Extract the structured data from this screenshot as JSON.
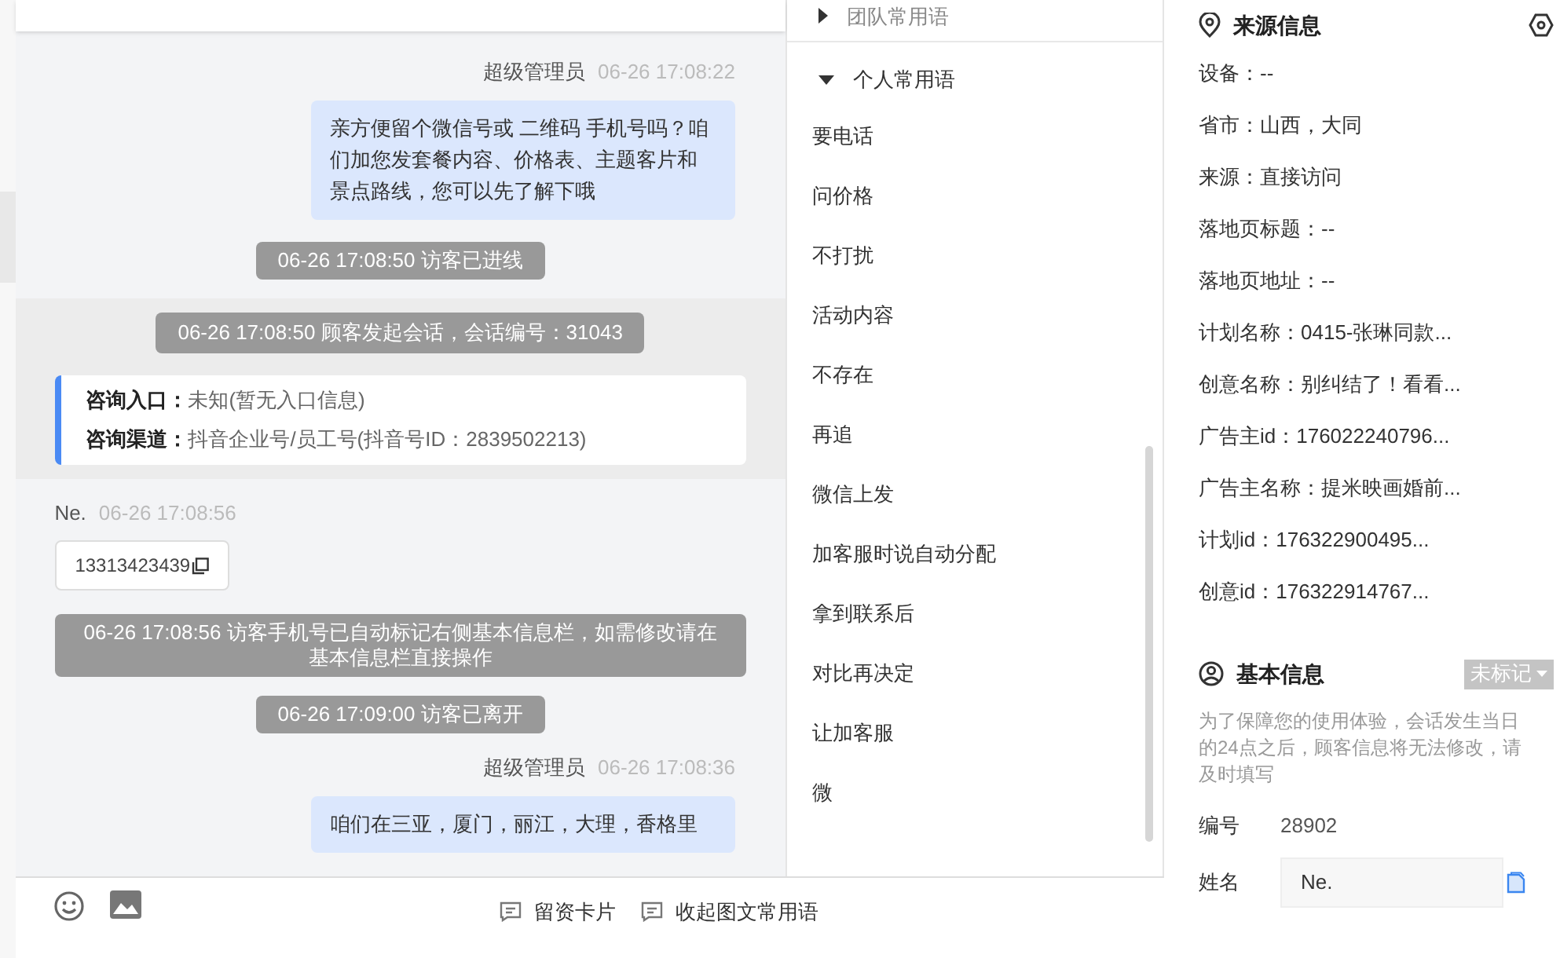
{
  "chat": {
    "messages": [
      {
        "kind": "agent",
        "sender": "超级管理员",
        "time": "06-26 17:08:22",
        "text": "亲方便留个微信号或 二维码 手机号吗？咱们加您发套餐内容、价格表、主题客片和景点路线，您可以先了解下哦"
      },
      {
        "kind": "system",
        "text": "06-26 17:08:50 访客已进线"
      },
      {
        "kind": "session",
        "text": "06-26 17:08:50 顾客发起会话，会话编号：31043",
        "fields": [
          {
            "label": "咨询入口：",
            "value": "未知(暂无入口信息)"
          },
          {
            "label": "咨询渠道：",
            "value": "抖音企业号/员工号(抖音号ID：2839502213)"
          }
        ]
      },
      {
        "kind": "visitor",
        "sender": "Ne.",
        "time": "06-26 17:08:56",
        "text": "13313423439"
      },
      {
        "kind": "system",
        "text": "06-26 17:08:56 访客手机号已自动标记右侧基本信息栏，如需修改请在基本信息栏直接操作"
      },
      {
        "kind": "system",
        "text": "06-26 17:09:00 访客已离开"
      },
      {
        "kind": "agent",
        "sender": "超级管理员",
        "time": "06-26 17:08:36",
        "text": "咱们在三亚，厦门，丽江，大理，香格里"
      }
    ]
  },
  "phrases": {
    "groups": [
      {
        "label": "团队常用语",
        "expanded": false
      },
      {
        "label": "个人常用语",
        "expanded": true
      }
    ],
    "items": [
      "要电话",
      "问价格",
      "不打扰",
      "活动内容",
      "不存在",
      "再追",
      "微信上发",
      "加客服时说自动分配",
      "拿到联系后",
      "对比再决定",
      "让加客服",
      "微"
    ],
    "footer": [
      "留资卡片",
      "收起图文常用语"
    ]
  },
  "source_info": {
    "title": "来源信息",
    "rows": [
      "设备：--",
      "省市：山西，大同",
      "来源：直接访问",
      "落地页标题：--",
      "落地页地址：--",
      "计划名称：0415-张琳同款...",
      "创意名称：别纠结了！看看...",
      "广告主id：176022240796...",
      "广告主名称：提米映画婚前...",
      "计划id：176322900495...",
      "创意id：176322914767..."
    ]
  },
  "basic_info": {
    "title": "基本信息",
    "tag": "未标记",
    "notice": "为了保障您的使用体验，会话发生当日的24点之后，顾客信息将无法修改，请及时填写",
    "fields": [
      {
        "kind": "text",
        "label": "编号",
        "value": "28902"
      },
      {
        "kind": "input",
        "label": "姓名",
        "value": "Ne."
      }
    ]
  }
}
